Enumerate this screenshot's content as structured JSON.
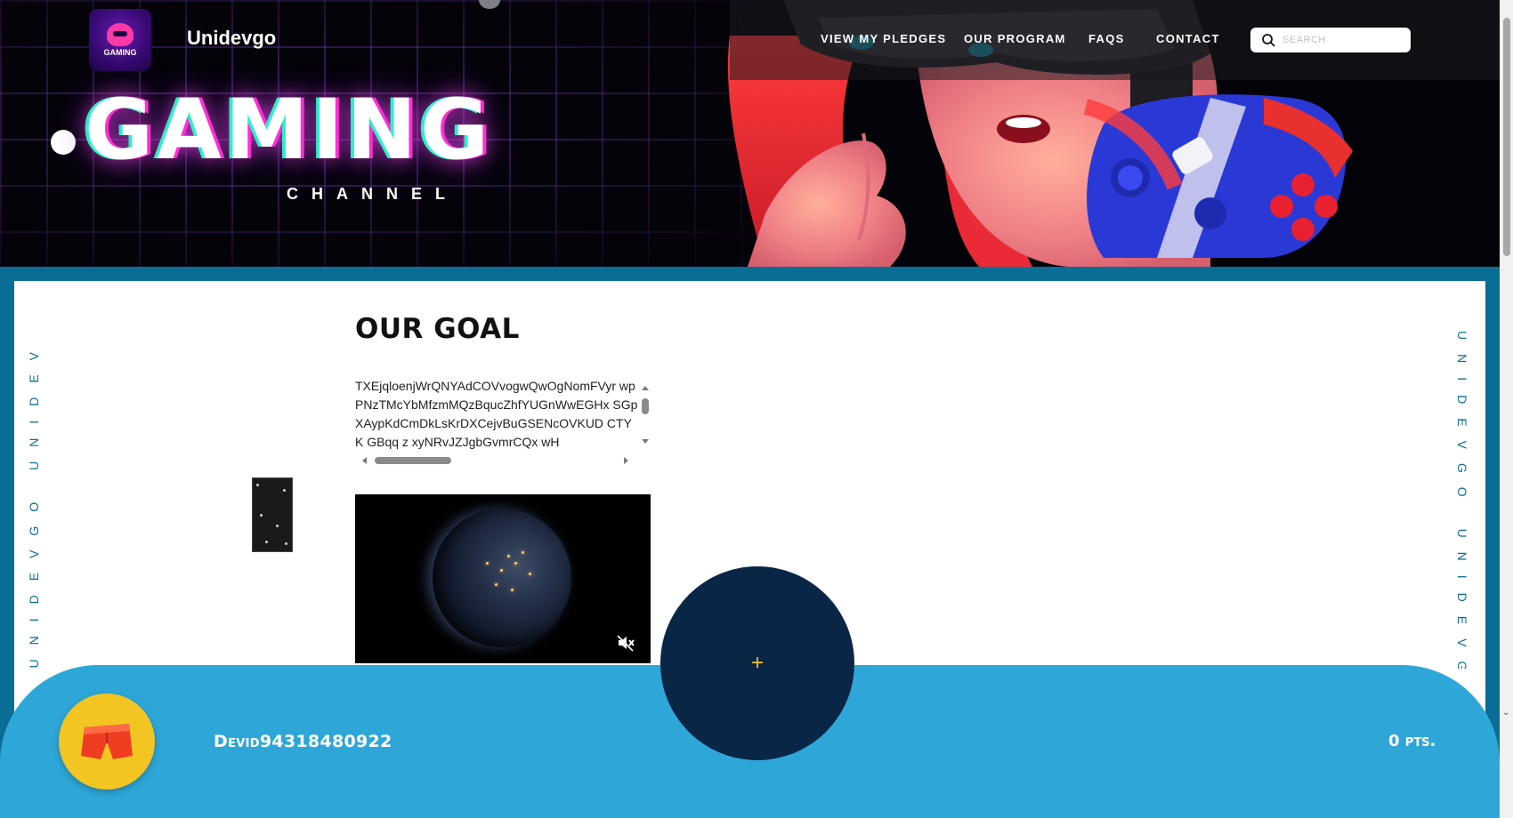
{
  "site": {
    "brand": "Unidevgo",
    "logo_text": "GAMING"
  },
  "nav": {
    "links": [
      {
        "label": "VIEW MY PLEDGES"
      },
      {
        "label": "OUR PROGRAM"
      },
      {
        "label": "FAQS"
      },
      {
        "label": "CONTACT"
      }
    ],
    "search_placeholder": "SEARCH"
  },
  "hero": {
    "title": "GAMING",
    "subtitle": "CHANNEL"
  },
  "side_text": {
    "left": "UNIDEVGO UNIDEV",
    "right": "UNIDEVGO UNIDEVGO"
  },
  "goal": {
    "title": "OUR GOAL",
    "body": "TXEjqloenjWrQNYAdCOVvogwQwOgNomFVyr wpPNzTMcYbMfzmMQzBqucZhfYUGnWwEGHx SGpXAypKdCmDkLsKrDXCejvBuGSENcOVKUD CTYK GBqq z xyNRvJZJgbGvmrCQx wH"
  },
  "video": {
    "muted": true
  },
  "fab": {
    "label": "+"
  },
  "user": {
    "id": "Devid94318480922",
    "points": "0 pts."
  },
  "colors": {
    "frame": "#0a6d96",
    "bottom_bar": "#2ea7d8",
    "fab": "#0a2647",
    "accent_yellow": "#f2c522"
  },
  "icons": {
    "search": "search-icon",
    "mute": "volume-mute-icon",
    "avatar": "shorts-icon"
  }
}
